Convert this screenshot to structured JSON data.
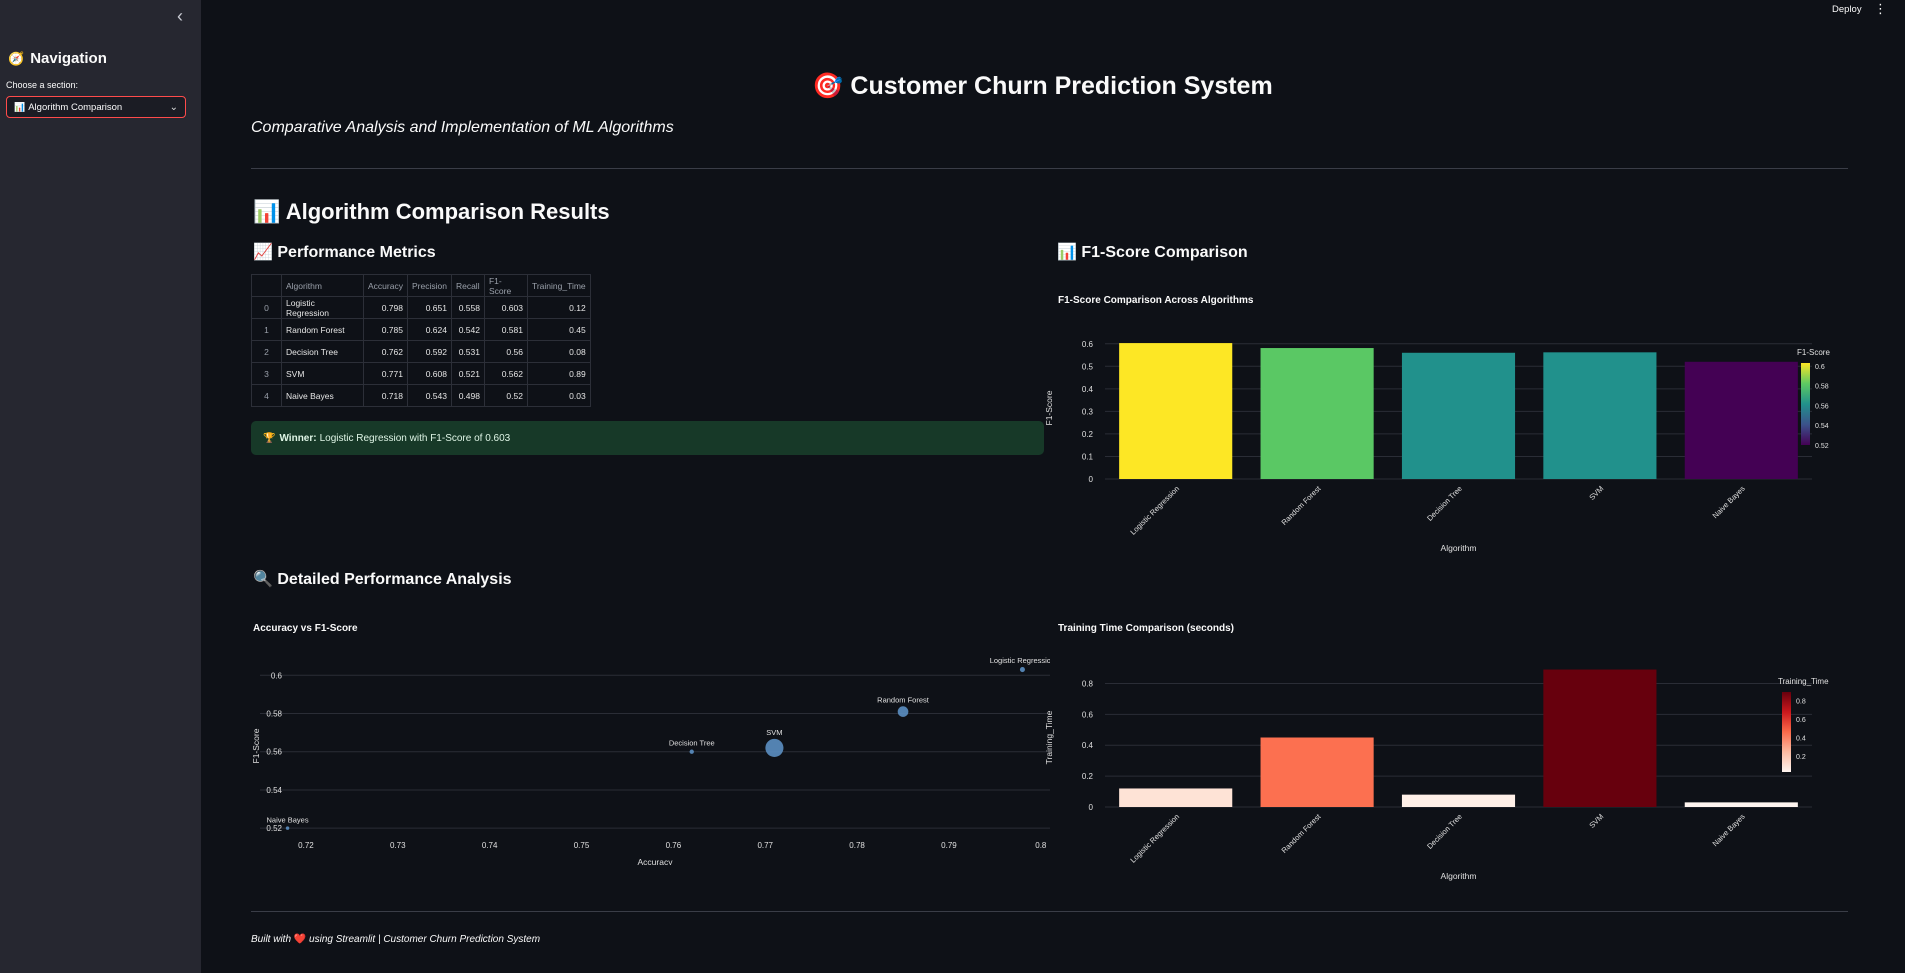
{
  "sidebar": {
    "title": "Navigation",
    "title_icon": "compass-icon",
    "select_label": "Choose a section:",
    "selected_option": "Algorithm Comparison"
  },
  "topbar": {
    "deploy_label": "Deploy"
  },
  "header": {
    "title": "Customer Churn Prediction System",
    "subtitle": "Comparative Analysis and Implementation of ML Algorithms"
  },
  "section_title": "Algorithm Comparison Results",
  "metrics": {
    "heading": "Performance Metrics",
    "columns": [
      "Algorithm",
      "Accuracy",
      "Precision",
      "Recall",
      "F1-Score",
      "Training_Time"
    ],
    "rows": [
      {
        "index": "0",
        "cells": [
          "Logistic Regression",
          "0.798",
          "0.651",
          "0.558",
          "0.603",
          "0.12"
        ]
      },
      {
        "index": "1",
        "cells": [
          "Random Forest",
          "0.785",
          "0.624",
          "0.542",
          "0.581",
          "0.45"
        ]
      },
      {
        "index": "2",
        "cells": [
          "Decision Tree",
          "0.762",
          "0.592",
          "0.531",
          "0.56",
          "0.08"
        ]
      },
      {
        "index": "3",
        "cells": [
          "SVM",
          "0.771",
          "0.608",
          "0.521",
          "0.562",
          "0.89"
        ]
      },
      {
        "index": "4",
        "cells": [
          "Naive Bayes",
          "0.718",
          "0.543",
          "0.498",
          "0.52",
          "0.03"
        ]
      }
    ]
  },
  "winner": {
    "label": "Winner:",
    "text": "Logistic Regression with F1-Score of 0.603"
  },
  "f1_section": {
    "heading": "F1-Score Comparison"
  },
  "detail_section": {
    "heading": "Detailed Performance Analysis"
  },
  "footer": {
    "prefix": "Built with",
    "suffix": "using Streamlit | Customer Churn Prediction System"
  },
  "chart_data": [
    {
      "type": "bar",
      "title": "F1-Score Comparison Across Algorithms",
      "xlabel": "Algorithm",
      "ylabel": "F1-Score",
      "categories": [
        "Logistic Regression",
        "Random Forest",
        "Decision Tree",
        "SVM",
        "Naive Bayes"
      ],
      "values": [
        0.603,
        0.581,
        0.56,
        0.562,
        0.52
      ],
      "colors": [
        "#fde725",
        "#5ac864",
        "#21918c",
        "#21918c",
        "#440154"
      ],
      "ylim": [
        0,
        0.63
      ],
      "yticks": [
        0,
        0.1,
        0.2,
        0.3,
        0.4,
        0.5,
        0.6
      ],
      "colorbar": {
        "title": "F1-Score",
        "ticks": [
          0.6,
          0.58,
          0.56,
          0.54,
          0.52
        ],
        "range": [
          0.52,
          0.603
        ]
      },
      "grid": true
    },
    {
      "type": "scatter",
      "title": "Accuracy vs F1-Score",
      "xlabel": "Accuracy",
      "ylabel": "F1-Score",
      "points": [
        {
          "label": "Logistic Regression",
          "x": 0.798,
          "y": 0.603,
          "size": 0.12
        },
        {
          "label": "Random Forest",
          "x": 0.785,
          "y": 0.581,
          "size": 0.45
        },
        {
          "label": "Decision Tree",
          "x": 0.762,
          "y": 0.56,
          "size": 0.08
        },
        {
          "label": "SVM",
          "x": 0.771,
          "y": 0.562,
          "size": 0.89
        },
        {
          "label": "Naive Bayes",
          "x": 0.718,
          "y": 0.52,
          "size": 0.03
        }
      ],
      "xlim": [
        0.715,
        0.801
      ],
      "ylim": [
        0.518,
        0.608
      ],
      "xticks": [
        0.72,
        0.73,
        0.74,
        0.75,
        0.76,
        0.77,
        0.78,
        0.79,
        0.8
      ],
      "yticks": [
        0.52,
        0.54,
        0.56,
        0.58,
        0.6
      ],
      "color": "#5b8fc2",
      "grid": true
    },
    {
      "type": "bar",
      "title": "Training Time Comparison (seconds)",
      "xlabel": "Algorithm",
      "ylabel": "Training_Time",
      "categories": [
        "Logistic Regression",
        "Random Forest",
        "Decision Tree",
        "SVM",
        "Naive Bayes"
      ],
      "values": [
        0.12,
        0.45,
        0.08,
        0.89,
        0.03
      ],
      "colors": [
        "#fee3d6",
        "#fc7050",
        "#fff0e8",
        "#67000d",
        "#fff5f0"
      ],
      "ylim": [
        0,
        0.9
      ],
      "yticks": [
        0,
        0.2,
        0.4,
        0.6,
        0.8
      ],
      "colorbar": {
        "title": "Training_Time",
        "ticks": [
          0.8,
          0.6,
          0.4,
          0.2
        ],
        "range": [
          0.03,
          0.89
        ]
      },
      "grid": true
    }
  ]
}
